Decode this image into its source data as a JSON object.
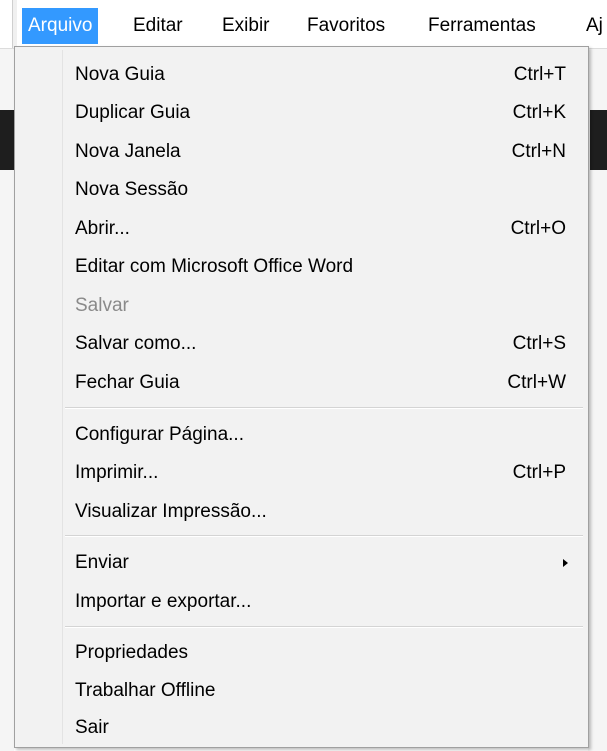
{
  "menubar": {
    "items": [
      {
        "label": "Arquivo",
        "active": true
      },
      {
        "label": "Editar",
        "active": false
      },
      {
        "label": "Exibir",
        "active": false
      },
      {
        "label": "Favoritos",
        "active": false
      },
      {
        "label": "Ferramentas",
        "active": false
      },
      {
        "label": "Aj",
        "active": false
      }
    ]
  },
  "file_menu": {
    "groups": [
      {
        "items": [
          {
            "label": "Nova Guia",
            "shortcut": "Ctrl+T",
            "enabled": true
          },
          {
            "label": "Duplicar Guia",
            "shortcut": "Ctrl+K",
            "enabled": true
          },
          {
            "label": "Nova Janela",
            "shortcut": "Ctrl+N",
            "enabled": true
          },
          {
            "label": "Nova Sessão",
            "shortcut": "",
            "enabled": true
          },
          {
            "label": "Abrir...",
            "shortcut": "Ctrl+O",
            "enabled": true
          },
          {
            "label": "Editar com Microsoft Office Word",
            "shortcut": "",
            "enabled": true
          },
          {
            "label": "Salvar",
            "shortcut": "",
            "enabled": false
          },
          {
            "label": "Salvar como...",
            "shortcut": "Ctrl+S",
            "enabled": true
          },
          {
            "label": "Fechar Guia",
            "shortcut": "Ctrl+W",
            "enabled": true
          }
        ]
      },
      {
        "items": [
          {
            "label": "Configurar Página...",
            "shortcut": "",
            "enabled": true
          },
          {
            "label": "Imprimir...",
            "shortcut": "Ctrl+P",
            "enabled": true
          },
          {
            "label": "Visualizar Impressão...",
            "shortcut": "",
            "enabled": true
          }
        ]
      },
      {
        "items": [
          {
            "label": "Enviar",
            "shortcut": "",
            "enabled": true,
            "submenu": true
          },
          {
            "label": "Importar e exportar...",
            "shortcut": "",
            "enabled": true
          }
        ]
      },
      {
        "items": [
          {
            "label": "Propriedades",
            "shortcut": "",
            "enabled": true
          },
          {
            "label": "Trabalhar Offline",
            "shortcut": "",
            "enabled": true
          },
          {
            "label": "Sair",
            "shortcut": "",
            "enabled": true
          }
        ]
      }
    ]
  },
  "colors": {
    "menubar_active_bg": "#3399ff",
    "menu_bg": "#f2f2f2",
    "disabled_text": "#8a8a8a"
  },
  "icons": {
    "submenu_arrow": "chevron-right-icon"
  }
}
